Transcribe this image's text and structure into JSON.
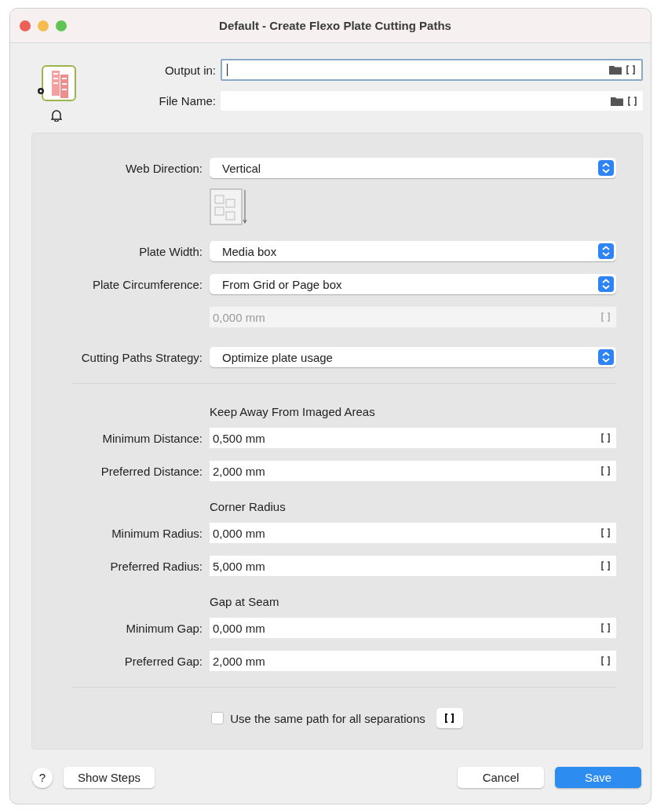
{
  "window": {
    "title": "Default - Create Flexo Plate Cutting Paths"
  },
  "header": {
    "fields": [
      {
        "label": "Output in:",
        "focused": true
      },
      {
        "label": "File Name:",
        "focused": false
      }
    ]
  },
  "settings": {
    "rows": [
      {
        "kind": "select",
        "label": "Web Direction:",
        "value": "Vertical"
      },
      {
        "kind": "diagram"
      },
      {
        "kind": "select",
        "label": "Plate Width:",
        "value": "Media box"
      },
      {
        "kind": "select",
        "label": "Plate Circumference:",
        "value": "From Grid or Page box"
      },
      {
        "kind": "field",
        "value": "0,000 mm",
        "disabled": true
      },
      {
        "kind": "select",
        "label": "Cutting Paths Strategy:",
        "value": "Optimize plate usage"
      },
      {
        "kind": "divider"
      },
      {
        "kind": "heading",
        "text": "Keep Away From Imaged Areas"
      },
      {
        "kind": "field",
        "label": "Minimum Distance:",
        "value": "0,500 mm",
        "disabled": false
      },
      {
        "kind": "field",
        "label": "Preferred Distance:",
        "value": "2,000 mm",
        "disabled": false
      },
      {
        "kind": "heading",
        "text": "Corner Radius"
      },
      {
        "kind": "field",
        "label": "Minimum Radius:",
        "value": "0,000 mm",
        "disabled": false
      },
      {
        "kind": "field",
        "label": "Preferred Radius:",
        "value": "5,000 mm",
        "disabled": false
      },
      {
        "kind": "heading",
        "text": "Gap at Seam"
      },
      {
        "kind": "field",
        "label": "Minimum Gap:",
        "value": "0,000 mm",
        "disabled": false
      },
      {
        "kind": "field",
        "label": "Preferred Gap:",
        "value": "2,000 mm",
        "disabled": false
      },
      {
        "kind": "divider"
      }
    ],
    "checkbox": {
      "label": "Use the same path for all separations",
      "checked": false
    }
  },
  "footer": {
    "help": "?",
    "buttons": [
      {
        "label": "Show Steps",
        "kind": "normal"
      },
      {
        "label": "Cancel",
        "kind": "normal"
      },
      {
        "label": "Save",
        "kind": "primary"
      }
    ]
  }
}
